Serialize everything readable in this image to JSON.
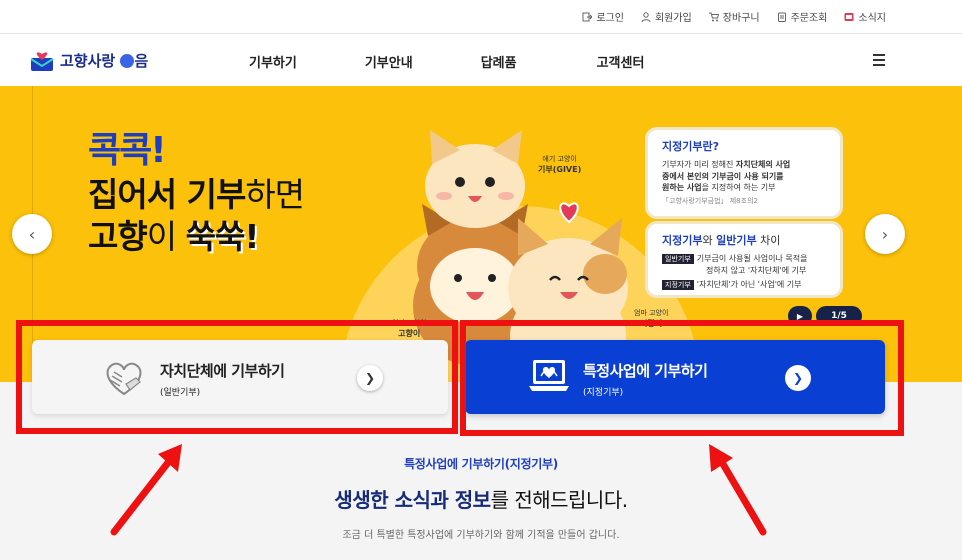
{
  "util_nav": [
    {
      "label": "로그인",
      "icon": "login-icon"
    },
    {
      "label": "회원가입",
      "icon": "user-icon"
    },
    {
      "label": "장바구니",
      "icon": "cart-icon"
    },
    {
      "label": "주문조회",
      "icon": "order-icon"
    },
    {
      "label": "소식지",
      "icon": "newsletter-icon"
    }
  ],
  "logo": {
    "text": "고향사랑",
    "suffix": "음",
    "icon": "heart-envelope-logo"
  },
  "main_nav": [
    "기부하기",
    "기부안내",
    "답례품",
    "고객센터"
  ],
  "banner": {
    "headline_1": "콕콕!",
    "headline_2a": "집어서 ",
    "headline_2b": "기부",
    "headline_2c": "하면",
    "headline_3a": "고향",
    "headline_3b": "이 ",
    "headline_3c": "쑥쑥!",
    "char_label_1a": "애기 고양이",
    "char_label_1b": "기부(GIVE)",
    "char_label_2a": "엄마 고양이",
    "char_label_2b": "고향이",
    "char_label_3a": "엄마 고양이",
    "char_label_3b": "시랑이",
    "info1": {
      "title": "지정기부란?",
      "text_1": "기부자가 미리 정해진 ",
      "text_bold_1": "자치단체의 사업",
      "text_2": "중에서 본인의 기부금이 사용 되기를",
      "text_3": "원하는 사업",
      "text_4": "을 지정하여 하는 기부",
      "source": "「고향사랑기부금법」 제8조의2"
    },
    "info2": {
      "title_a": "지정기부",
      "title_b": "와 ",
      "title_c": "일반기부",
      "title_d": " 차이",
      "row1_tag": "일반기부",
      "row1_text_a": "기부금이 사용될 사업이나 목적을",
      "row1_text_b": "정하지 않고 '자치단체'에 기부",
      "row2_tag": "지정기부",
      "row2_text": "'자치단체'가 아닌 '사업'에 기부"
    },
    "page_indicator": "1/5"
  },
  "cards": {
    "general": {
      "title": "자치단체에 기부하기",
      "sub": "(일반기부)"
    },
    "specific": {
      "title": "특정사업에 기부하기",
      "sub": "(지정기부)"
    }
  },
  "section": {
    "eyebrow": "특정사업에 기부하기(지정기부)",
    "heading_a": "생생한 소식과 정보",
    "heading_b": "를 전해드립니다.",
    "desc": "조금 더 특별한 특정사업에 기부하기와 함께 기적을 만들어 갑니다."
  },
  "colors": {
    "banner_bg": "#fcc10a",
    "brand_blue": "#0a3fd4",
    "annotation_red": "#ee1111"
  }
}
